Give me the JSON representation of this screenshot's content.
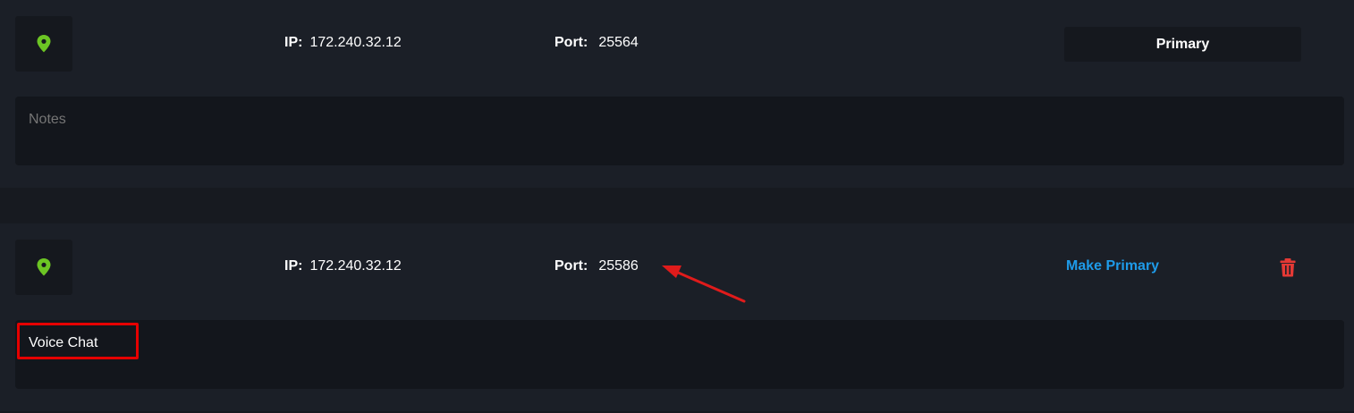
{
  "servers": [
    {
      "ip_label": "IP:",
      "ip": "172.240.32.12",
      "port_label": "Port:",
      "port": "25564",
      "primary_label": "Primary",
      "notes_placeholder": "Notes",
      "notes_value": ""
    },
    {
      "ip_label": "IP:",
      "ip": "172.240.32.12",
      "port_label": "Port:",
      "port": "25586",
      "make_primary_label": "Make Primary",
      "notes_value": "Voice Chat"
    }
  ],
  "icons": {
    "location": "map-pin-icon",
    "delete": "trash-icon"
  },
  "colors": {
    "accent_green": "#6cc524",
    "link_blue": "#1e9be9",
    "delete_red": "#e53935",
    "annotation_red": "#e50000"
  }
}
